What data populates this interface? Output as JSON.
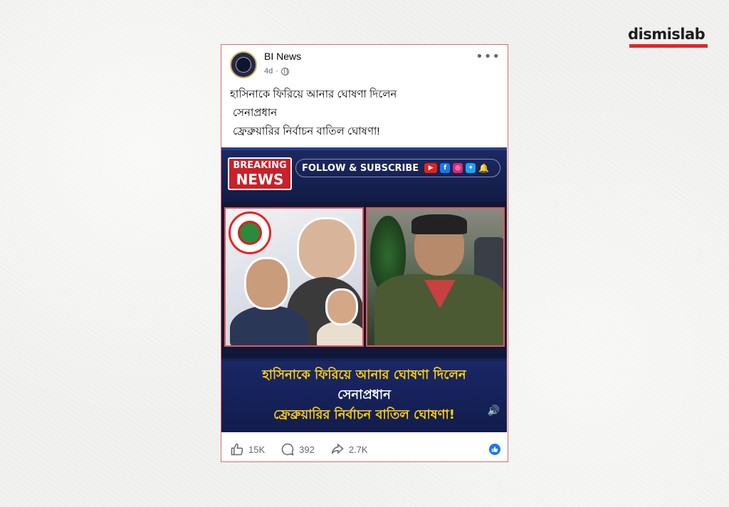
{
  "brand": {
    "name": "dismislab",
    "accent": "#e0262a"
  },
  "post": {
    "page_name": "BI News",
    "time": "4d",
    "separator": "·",
    "privacy_icon": "globe-icon",
    "more_icon": "•••",
    "caption_lines": [
      "হাসিনাকে ফিরিয়ে আনার ঘোষণা দিলেন",
      "সেনাপ্রধান",
      "ফ্রেব্রুয়ারির নির্বাচন বাতিল ঘোষণা!"
    ]
  },
  "media": {
    "breaking": "BREAKING",
    "news": "NEWS",
    "follow": "FOLLOW & SUBSCRIBE",
    "social_icons": [
      "youtube-icon",
      "facebook-icon",
      "instagram-icon",
      "twitter-icon",
      "bell-icon"
    ],
    "headline_lines": [
      "হাসিনাকে ফিরিয়ে আনার ঘোষণা দিলেন",
      "সেনাপ্রধান",
      "ফ্রেব্রুয়ারির নির্বাচন বাতিল ঘোষণা!"
    ],
    "colors": {
      "headline_yellow": "#ffd100",
      "panel_blue": "#15224f",
      "breaking_red": "#c9202a"
    }
  },
  "footer": {
    "likes": "15K",
    "comments": "392",
    "shares": "2.7K"
  }
}
